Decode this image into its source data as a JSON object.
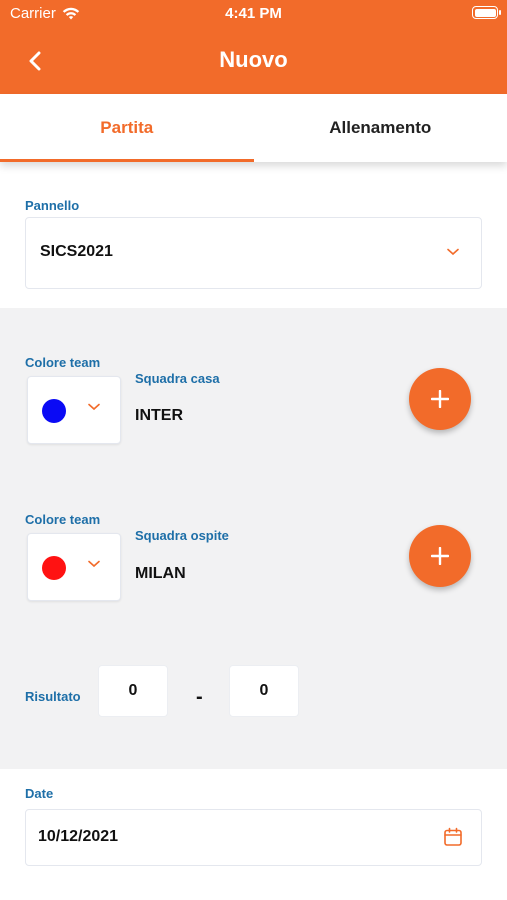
{
  "status_bar": {
    "carrier": "Carrier",
    "time": "4:41 PM"
  },
  "header": {
    "title": "Nuovo"
  },
  "tabs": [
    {
      "label": "Partita",
      "active": true
    },
    {
      "label": "Allenamento",
      "active": false
    }
  ],
  "panel": {
    "label": "Pannello",
    "value": "SICS2021"
  },
  "home": {
    "color_label": "Colore team",
    "color": "#0a0af5",
    "team_label": "Squadra casa",
    "team": "INTER"
  },
  "away": {
    "color_label": "Colore team",
    "color": "#ff1212",
    "team_label": "Squadra ospite",
    "team": "MILAN"
  },
  "result": {
    "label": "Risultato",
    "home_score": "0",
    "separator": "-",
    "away_score": "0"
  },
  "date": {
    "label": "Date",
    "value": "10/12/2021"
  },
  "colors": {
    "accent": "#f26b2a",
    "label_blue": "#1e6fa8",
    "grey_bg": "#f2f2f3"
  }
}
